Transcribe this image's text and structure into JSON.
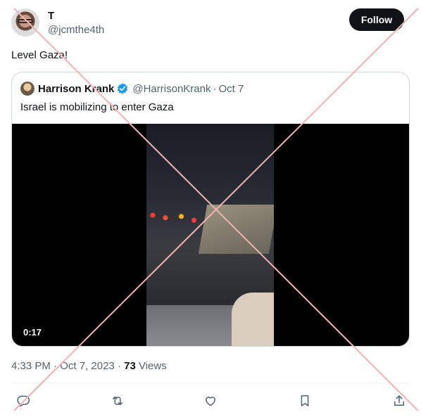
{
  "tweet": {
    "author_name": "T",
    "author_handle": "@jcmthe4th",
    "follow_label": "Follow",
    "text": "Level Gaza!",
    "time": "4:33 PM",
    "date": "Oct 7, 2023",
    "views_count": "73",
    "views_label": "Views"
  },
  "quote": {
    "author_name": "Harrison Krank",
    "author_handle": "@HarrisonKrank",
    "date": "Oct 7",
    "text": "Israel is mobilizing to enter Gaza",
    "video_duration": "0:17"
  },
  "actions": {
    "reply_icon": "reply-icon",
    "retweet_icon": "retweet-icon",
    "like_icon": "heart-icon",
    "bookmark_icon": "bookmark-icon",
    "share_icon": "share-icon"
  },
  "colors": {
    "accent_verified": "#1d9bf0",
    "follow_bg": "#0f1419",
    "secondary_text": "#536471",
    "watermark_x": "#f2b3b3"
  }
}
